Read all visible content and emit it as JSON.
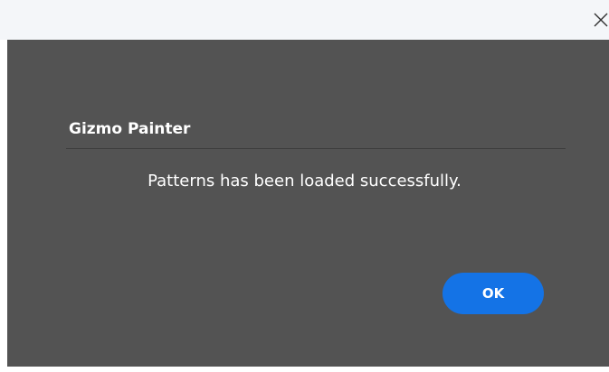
{
  "window": {
    "close_icon": "close-icon",
    "titlebar_color": "#f4f6f9",
    "background_color": "#535353"
  },
  "dialog": {
    "title": "Gizmo Painter",
    "message": "Patterns has been loaded successfully.",
    "ok_label": "OK",
    "accent_color": "#1473e6"
  }
}
